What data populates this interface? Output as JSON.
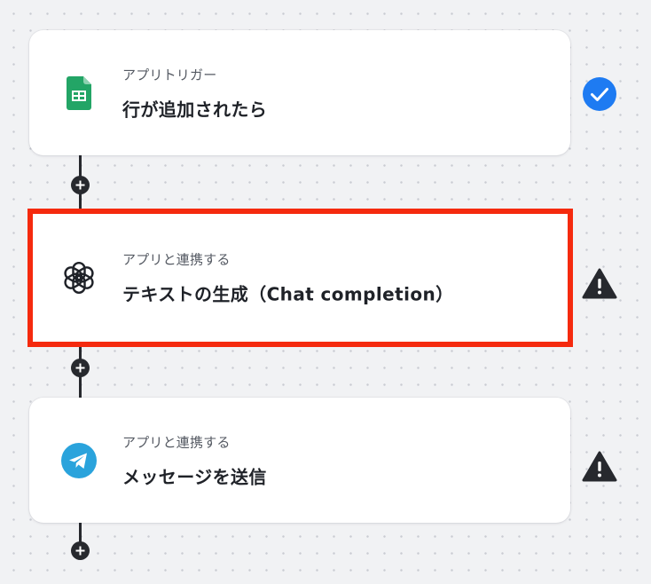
{
  "flow": {
    "steps": [
      {
        "subtitle": "アプリトリガー",
        "title": "行が追加されたら",
        "app_icon": "google-sheets-icon",
        "status_icon": "check-circle-icon",
        "status": "completed"
      },
      {
        "subtitle": "アプリと連携する",
        "title": "テキストの生成（Chat completion）",
        "app_icon": "openai-icon",
        "status_icon": "warning-icon",
        "status": "warning"
      },
      {
        "subtitle": "アプリと連携する",
        "title": "メッセージを送信",
        "app_icon": "telegram-icon",
        "status_icon": "warning-icon",
        "status": "warning"
      }
    ],
    "add_step_icon": "plus-icon"
  },
  "colors": {
    "highlight_border": "#f52a0e",
    "check_blue": "#1e7bf2",
    "warning_dark": "#27292e",
    "sheets_green": "#23a566",
    "telegram_blue": "#2aa3dc",
    "connector": "#27292e",
    "canvas_bg": "#f1f2f4"
  }
}
